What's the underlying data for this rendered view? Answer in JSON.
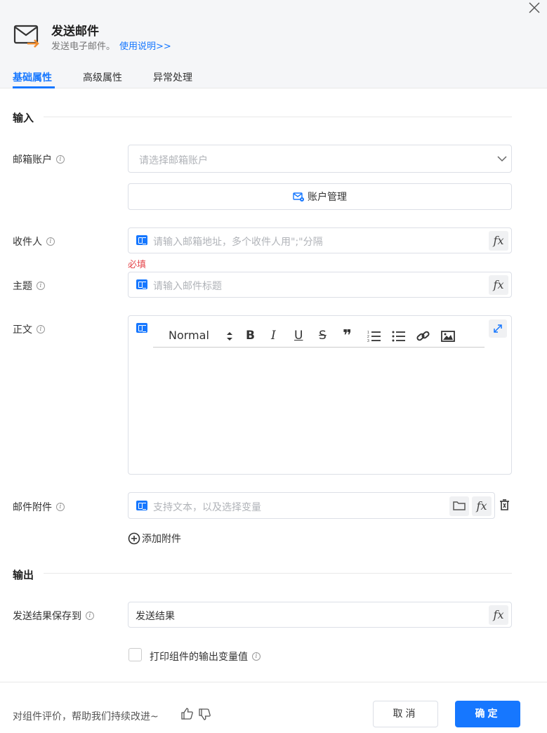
{
  "header": {
    "title": "发送邮件",
    "subtitle": "发送电子邮件。",
    "help_link": "使用说明>>"
  },
  "tabs": [
    {
      "label": "基础属性",
      "active": true
    },
    {
      "label": "高级属性",
      "active": false
    },
    {
      "label": "异常处理",
      "active": false
    }
  ],
  "input_section": {
    "title": "输入",
    "account": {
      "label": "邮箱账户",
      "placeholder": "请选择邮箱账户",
      "manage_button": "账户管理"
    },
    "recipient": {
      "label": "收件人",
      "placeholder": "请输入邮箱地址，多个收件人用\";\"分隔",
      "required_text": "必填"
    },
    "subject": {
      "label": "主题",
      "placeholder": "请输入邮件标题"
    },
    "body": {
      "label": "正文",
      "format_select": "Normal"
    },
    "attachment": {
      "label": "邮件附件",
      "placeholder": "支持文本，以及选择变量",
      "add_label": "添加附件"
    }
  },
  "output_section": {
    "title": "输出",
    "result": {
      "label": "发送结果保存到",
      "value": "发送结果"
    },
    "print_checkbox": {
      "label": "打印组件的输出变量值",
      "checked": false
    }
  },
  "footer": {
    "feedback_text": "对组件评价，帮助我们持续改进~",
    "cancel_label": "取消",
    "confirm_label": "确定"
  },
  "colors": {
    "accent": "#1677ff",
    "required": "#e5484d",
    "header_bg": "#f5f6f8",
    "mail_icon_arrow": "#f08c2e"
  }
}
